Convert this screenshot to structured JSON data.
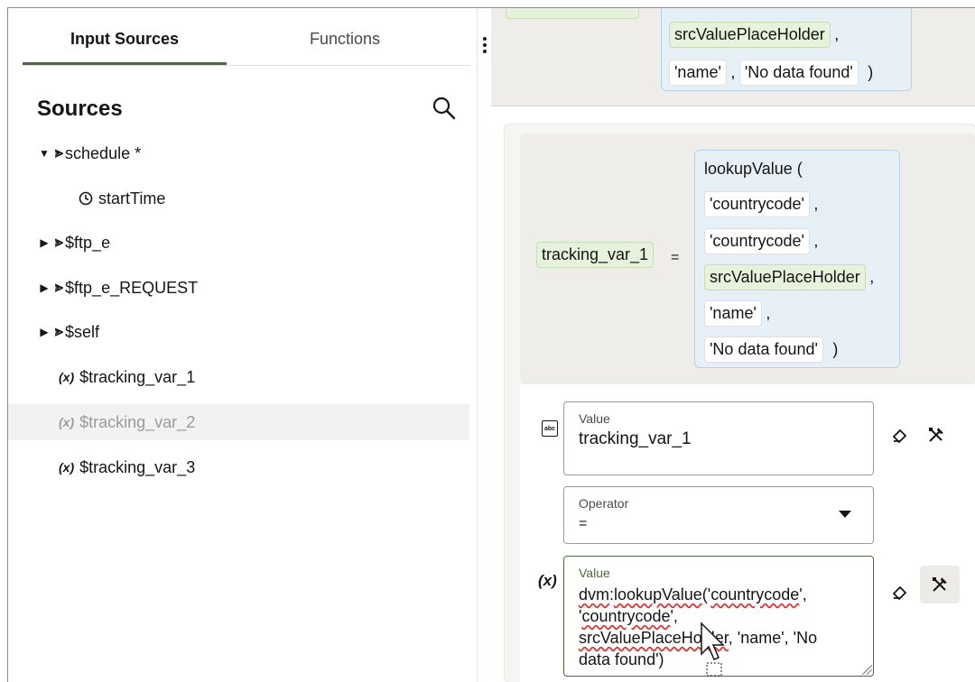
{
  "tabs": {
    "input_sources": "Input Sources",
    "functions": "Functions"
  },
  "sources_title": "Sources",
  "tree": [
    {
      "label": "schedule *",
      "icon": "object-icon",
      "arrow": "▼"
    },
    {
      "label": "startTime",
      "icon": "clock-icon"
    },
    {
      "label": "$ftp_e",
      "icon": "object-icon",
      "arrow": "▶"
    },
    {
      "label": "$ftp_e_REQUEST",
      "icon": "object-icon",
      "arrow": "▶"
    },
    {
      "label": "$self",
      "icon": "object-icon",
      "arrow": "▶"
    },
    {
      "label": "$tracking_var_1",
      "icon": "variable-icon",
      "prefix": "(x)"
    },
    {
      "label": "$tracking_var_2",
      "icon": "variable-icon",
      "prefix": "(x)"
    },
    {
      "label": "$tracking_var_3",
      "icon": "variable-icon",
      "prefix": "(x)"
    }
  ],
  "top_expression": {
    "src": "srcValuePlaceHolder",
    "comma": ",",
    "name": "'name'",
    "nodata": "'No data found'",
    "close": ")"
  },
  "expression": {
    "variable": "tracking_var_1",
    "equals": "=",
    "func": "lookupValue (",
    "arg1": "'countrycode'",
    "arg2": "'countrycode'",
    "arg3": "srcValuePlaceHolder",
    "arg4": "'name'",
    "arg5": "'No data found'",
    "comma": ",",
    "close": ")"
  },
  "form": {
    "value1_label": "Value",
    "value1": "tracking_var_1",
    "operator_label": "Operator",
    "operator": "=",
    "value2_label": "Value",
    "value2_line1a": "dvm",
    "value2_line1b": ":",
    "value2_line1c": "lookupValue",
    "value2_line1d": "('",
    "value2_line1e": "countrycode",
    "value2_line1f": "',",
    "value2_line2a": "'",
    "value2_line2b": "countrycode",
    "value2_line2c": "',",
    "value2_line3a": "srcValuePlaceHolder",
    "value2_line3b": ", 'name', 'No",
    "value2_line4": "data found')",
    "abc_icon": "abc",
    "x_icon": "(x)"
  },
  "colors": {
    "accent_green": "#4c6a3f",
    "chip_green": "#e6f2dc",
    "lookup_blue": "#e6f0f6"
  }
}
